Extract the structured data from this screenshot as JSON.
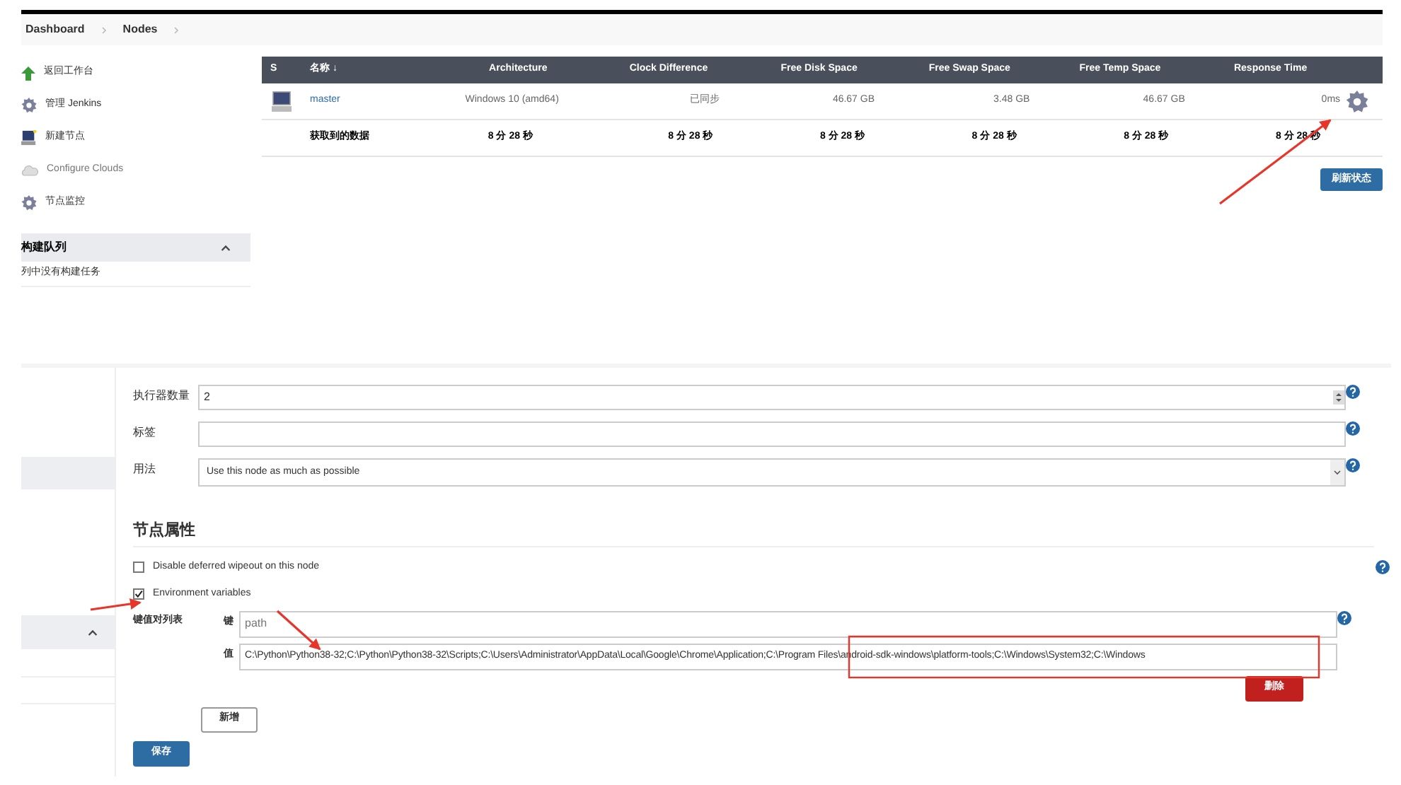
{
  "breadcrumb": [
    {
      "label": "Dashboard"
    },
    {
      "label": "Nodes"
    }
  ],
  "sidebar": {
    "items": [
      {
        "label": "返回工作台",
        "kind": "up"
      },
      {
        "label": "管理 Jenkins",
        "kind": "gear"
      },
      {
        "label": "新建节点",
        "kind": "computer"
      },
      {
        "label": "Configure Clouds",
        "kind": "cloud"
      },
      {
        "label": "节点监控",
        "kind": "gear"
      }
    ],
    "queue": {
      "title": "构建队列",
      "expanded": true,
      "message": "列中没有构建任务"
    }
  },
  "nodes_table": {
    "columns": [
      "S",
      "名称 ↓",
      "Architecture",
      "Clock Difference",
      "Free Disk Space",
      "Free Swap Space",
      "Free Temp Space",
      "Response Time"
    ],
    "rows": [
      {
        "kind": "node",
        "cells": [
          "",
          "master",
          "Windows 10 (amd64)",
          "已同步",
          "46.67 GB",
          "3.48 GB",
          "46.67 GB",
          "0ms"
        ]
      },
      {
        "kind": "summary",
        "cells": [
          "",
          "获取到的数据",
          "8 分 28 秒",
          "8 分 28 秒",
          "8 分 28 秒",
          "8 分 28 秒",
          "8 分 28 秒",
          "8 分 28 秒"
        ]
      }
    ],
    "refresh_button": "刷新状态"
  },
  "form": {
    "fields": [
      {
        "kind": "number",
        "label": "执行器数量",
        "value": "2"
      },
      {
        "kind": "text",
        "label": "标签"
      },
      {
        "kind": "select",
        "label": "用法",
        "value": "Use this node as much as possible"
      }
    ],
    "section_title": "节点属性",
    "checkboxes": [
      {
        "label": "Disable deferred wipeout on this node",
        "checked": false
      },
      {
        "label": "Environment variables",
        "checked": true
      }
    ],
    "env": {
      "label": "键值对列表",
      "key_label": "键",
      "key": "path",
      "value_label": "值",
      "value": "C:\\Python\\Python38-32;C:\\Python\\Python38-32\\Scripts;C:\\Users\\Administrator\\AppData\\Local\\Google\\Chrome\\Application;C:\\Program Files\\android-sdk-windows\\platform-tools;C:\\Windows\\System32;C:\\Windows",
      "delete_button": "删除"
    },
    "add_button": "新增",
    "save_button": "保存"
  }
}
